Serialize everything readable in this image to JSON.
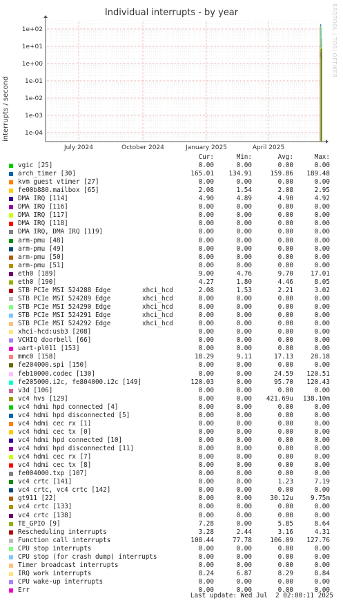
{
  "chart_data": {
    "type": "line",
    "title": "Individual interrupts - by year",
    "ylabel": "interrupts / second",
    "y_scale": "log",
    "ylim": [
      3e-05,
      300
    ],
    "y_ticks": [
      "1e-04",
      "1e-03",
      "1e-02",
      "1e-01",
      "1e+00",
      "1e+01",
      "1e+02"
    ],
    "x_ticks": [
      "July 2024",
      "October 2024",
      "January 2025",
      "April 2025"
    ],
    "grid": true,
    "watermark": "RRDTOOL / TOBI OETIKER",
    "columns": [
      "Cur:",
      "Min:",
      "Avg:",
      "Max:"
    ],
    "series": [
      {
        "name": "vgic [25]",
        "color": "#00cc00",
        "cur": "0.00",
        "min": "0.00",
        "avg": "0.00",
        "max": "0.00"
      },
      {
        "name": "arch_timer [30]",
        "color": "#0066b3",
        "cur": "165.01",
        "min": "134.91",
        "avg": "159.86",
        "max": "189.48"
      },
      {
        "name": "kvm guest vtimer [27]",
        "color": "#ff8000",
        "cur": "0.00",
        "min": "0.00",
        "avg": "0.00",
        "max": "0.00"
      },
      {
        "name": "fe00b880.mailbox [65]",
        "color": "#ffcc00",
        "cur": "2.08",
        "min": "1.54",
        "avg": "2.08",
        "max": "2.95"
      },
      {
        "name": "DMA IRQ [114]",
        "color": "#330099",
        "cur": "4.90",
        "min": "4.89",
        "avg": "4.90",
        "max": "4.92"
      },
      {
        "name": "DMA IRQ [116]",
        "color": "#990099",
        "cur": "0.00",
        "min": "0.00",
        "avg": "0.00",
        "max": "0.00"
      },
      {
        "name": "DMA IRQ [117]",
        "color": "#ccff00",
        "cur": "0.00",
        "min": "0.00",
        "avg": "0.00",
        "max": "0.00"
      },
      {
        "name": "DMA IRQ [118]",
        "color": "#ff0000",
        "cur": "0.00",
        "min": "0.00",
        "avg": "0.00",
        "max": "0.00"
      },
      {
        "name": "DMA IRQ, DMA IRQ [119]",
        "color": "#808080",
        "cur": "0.00",
        "min": "0.00",
        "avg": "0.00",
        "max": "0.00"
      },
      {
        "name": "arm-pmu [48]",
        "color": "#008f00",
        "cur": "0.00",
        "min": "0.00",
        "avg": "0.00",
        "max": "0.00"
      },
      {
        "name": "arm-pmu [49]",
        "color": "#00487d",
        "cur": "0.00",
        "min": "0.00",
        "avg": "0.00",
        "max": "0.00"
      },
      {
        "name": "arm-pmu [50]",
        "color": "#b35a00",
        "cur": "0.00",
        "min": "0.00",
        "avg": "0.00",
        "max": "0.00"
      },
      {
        "name": "arm-pmu [51]",
        "color": "#b38f00",
        "cur": "0.00",
        "min": "0.00",
        "avg": "0.00",
        "max": "0.00"
      },
      {
        "name": "eth0 [189]",
        "color": "#6b006b",
        "cur": "9.00",
        "min": "4.76",
        "avg": "9.70",
        "max": "17.01"
      },
      {
        "name": "eth0 [190]",
        "color": "#8fb300",
        "cur": "4.27",
        "min": "1.80",
        "avg": "4.46",
        "max": "8.05"
      },
      {
        "name": "STB PCIe MSI 524288 Edge",
        "extra": "xhci_hcd",
        "color": "#b30000",
        "cur": "2.08",
        "min": "1.53",
        "avg": "2.21",
        "max": "3.02"
      },
      {
        "name": "STB PCIe MSI 524289 Edge",
        "extra": "xhci_hcd",
        "color": "#bebebe",
        "cur": "0.00",
        "min": "0.00",
        "avg": "0.00",
        "max": "0.00"
      },
      {
        "name": "STB PCIe MSI 524290 Edge",
        "extra": "xhci_hcd",
        "color": "#80ff80",
        "cur": "0.00",
        "min": "0.00",
        "avg": "0.00",
        "max": "0.00"
      },
      {
        "name": "STB PCIe MSI 524291 Edge",
        "extra": "xhci_hcd",
        "color": "#80c9ff",
        "cur": "0.00",
        "min": "0.00",
        "avg": "0.00",
        "max": "0.00"
      },
      {
        "name": "STB PCIe MSI 524292 Edge",
        "extra": "xhci_hcd",
        "color": "#ffc080",
        "cur": "0.00",
        "min": "0.00",
        "avg": "0.00",
        "max": "0.00"
      },
      {
        "name": "xhci-hcd:usb3 [208]",
        "color": "#ffe680",
        "cur": "0.00",
        "min": "0.00",
        "avg": "0.00",
        "max": "0.00"
      },
      {
        "name": "VCHIQ doorbell [66]",
        "color": "#aa80ff",
        "cur": "0.00",
        "min": "0.00",
        "avg": "0.00",
        "max": "0.00"
      },
      {
        "name": "uart-pl011 [153]",
        "color": "#ee00cc",
        "cur": "0.00",
        "min": "0.00",
        "avg": "0.00",
        "max": "0.00"
      },
      {
        "name": "mmc0 [158]",
        "color": "#ff8080",
        "cur": "18.29",
        "min": "9.11",
        "avg": "17.13",
        "max": "28.18"
      },
      {
        "name": "fe204000.spi [150]",
        "color": "#666600",
        "cur": "0.00",
        "min": "0.00",
        "avg": "0.00",
        "max": "0.00"
      },
      {
        "name": "feb10000.codec [130]",
        "color": "#ffbfff",
        "cur": "0.00",
        "min": "0.00",
        "avg": "24.59",
        "max": "120.51"
      },
      {
        "name": "fe205000.i2c, fe804000.i2c [149]",
        "color": "#00ffcc",
        "cur": "120.03",
        "min": "0.00",
        "avg": "95.70",
        "max": "120.43"
      },
      {
        "name": "v3d [106]",
        "color": "#cc6699",
        "cur": "0.00",
        "min": "0.00",
        "avg": "0.00",
        "max": "0.00"
      },
      {
        "name": "vc4 hvs [129]",
        "color": "#999900",
        "cur": "0.00",
        "min": "0.00",
        "avg": "421.69u",
        "max": "138.10m"
      },
      {
        "name": "vc4 hdmi hpd connected [4]",
        "color": "#00cc00",
        "cur": "0.00",
        "min": "0.00",
        "avg": "0.00",
        "max": "0.00"
      },
      {
        "name": "vc4 hdmi hpd disconnected [5]",
        "color": "#0066b3",
        "cur": "0.00",
        "min": "0.00",
        "avg": "0.00",
        "max": "0.00"
      },
      {
        "name": "vc4 hdmi cec rx [1]",
        "color": "#ff8000",
        "cur": "0.00",
        "min": "0.00",
        "avg": "0.00",
        "max": "0.00"
      },
      {
        "name": "vc4 hdmi cec tx [0]",
        "color": "#ffcc00",
        "cur": "0.00",
        "min": "0.00",
        "avg": "0.00",
        "max": "0.00"
      },
      {
        "name": "vc4 hdmi hpd connected [10]",
        "color": "#330099",
        "cur": "0.00",
        "min": "0.00",
        "avg": "0.00",
        "max": "0.00"
      },
      {
        "name": "vc4 hdmi hpd disconnected [11]",
        "color": "#990099",
        "cur": "0.00",
        "min": "0.00",
        "avg": "0.00",
        "max": "0.00"
      },
      {
        "name": "vc4 hdmi cec rx [7]",
        "color": "#ccff00",
        "cur": "0.00",
        "min": "0.00",
        "avg": "0.00",
        "max": "0.00"
      },
      {
        "name": "vc4 hdmi cec tx [8]",
        "color": "#ff0000",
        "cur": "0.00",
        "min": "0.00",
        "avg": "0.00",
        "max": "0.00"
      },
      {
        "name": "fe004000.txp [107]",
        "color": "#808080",
        "cur": "0.00",
        "min": "0.00",
        "avg": "0.00",
        "max": "0.00"
      },
      {
        "name": "vc4 crtc [141]",
        "color": "#008f00",
        "cur": "0.00",
        "min": "0.00",
        "avg": "1.23",
        "max": "7.19"
      },
      {
        "name": "vc4 crtc, vc4 crtc [142]",
        "color": "#00487d",
        "cur": "0.00",
        "min": "0.00",
        "avg": "0.00",
        "max": "0.00"
      },
      {
        "name": "gt911 [22]",
        "color": "#b35a00",
        "cur": "0.00",
        "min": "0.00",
        "avg": "30.12u",
        "max": "9.75m"
      },
      {
        "name": "vc4 crtc [133]",
        "color": "#b38f00",
        "cur": "0.00",
        "min": "0.00",
        "avg": "0.00",
        "max": "0.00"
      },
      {
        "name": "vc4 crtc [138]",
        "color": "#6b006b",
        "cur": "0.00",
        "min": "0.00",
        "avg": "0.00",
        "max": "0.00"
      },
      {
        "name": "TE_GPIO [9]",
        "color": "#8fb300",
        "cur": "7.28",
        "min": "0.00",
        "avg": "5.85",
        "max": "8.64"
      },
      {
        "name": "Rescheduling interrupts",
        "color": "#b30000",
        "cur": "3.28",
        "min": "2.44",
        "avg": "3.16",
        "max": "4.31"
      },
      {
        "name": "Function call interrupts",
        "color": "#bebebe",
        "cur": "108.44",
        "min": "77.78",
        "avg": "106.09",
        "max": "127.76"
      },
      {
        "name": "CPU stop interrupts",
        "color": "#80ff80",
        "cur": "0.00",
        "min": "0.00",
        "avg": "0.00",
        "max": "0.00"
      },
      {
        "name": "CPU stop (for crash dump) interrupts",
        "color": "#80c9ff",
        "cur": "0.00",
        "min": "0.00",
        "avg": "0.00",
        "max": "0.00"
      },
      {
        "name": "Timer broadcast interrupts",
        "color": "#ffc080",
        "cur": "0.00",
        "min": "0.00",
        "avg": "0.00",
        "max": "0.00"
      },
      {
        "name": "IRQ work interrupts",
        "color": "#ffe680",
        "cur": "8.24",
        "min": "6.87",
        "avg": "8.29",
        "max": "8.84"
      },
      {
        "name": "CPU wake-up interrupts",
        "color": "#aa80ff",
        "cur": "0.00",
        "min": "0.00",
        "avg": "0.00",
        "max": "0.00"
      },
      {
        "name": "Err",
        "color": "#ee00cc",
        "cur": "0.00",
        "min": "0.00",
        "avg": "0.00",
        "max": "0.00"
      }
    ],
    "footer": "Last update: Wed Jul  2 02:00:11 2025"
  }
}
